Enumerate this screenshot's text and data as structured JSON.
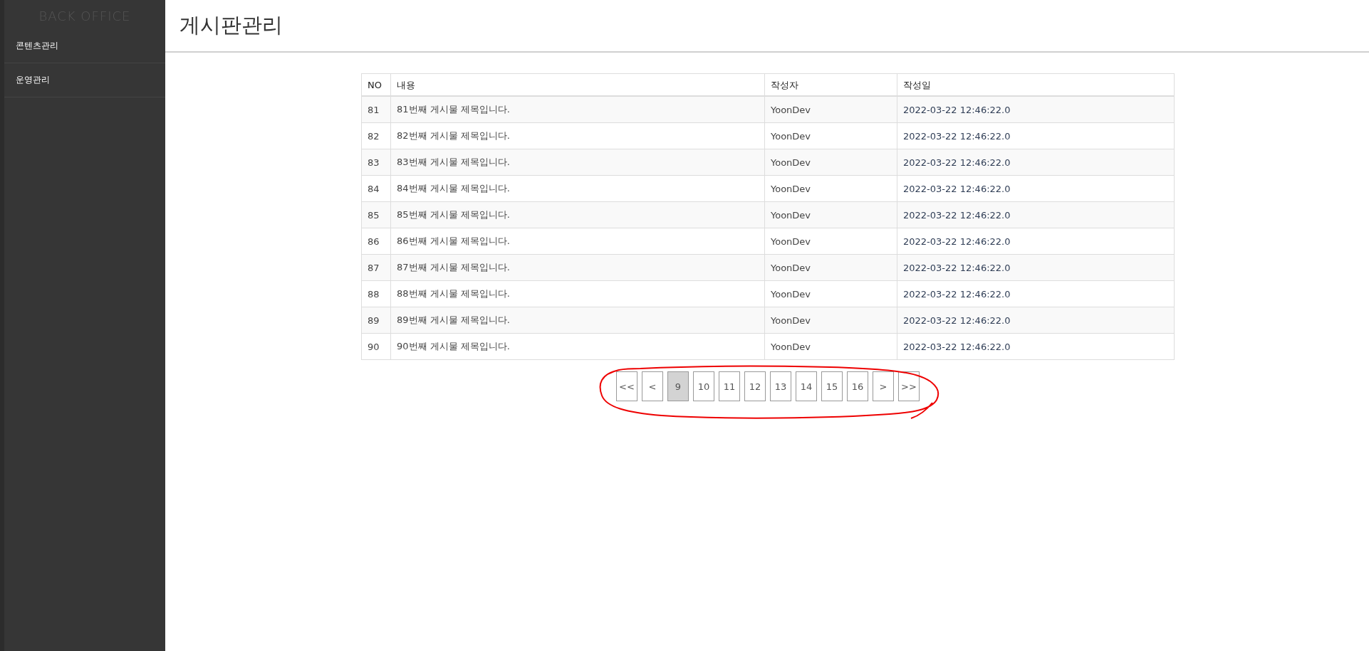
{
  "sidebar": {
    "logo": "BACK OFFICE",
    "items": [
      {
        "label": "콘텐츠관리"
      },
      {
        "label": "운영관리"
      }
    ]
  },
  "page_title": "게시판관리",
  "table": {
    "columns": [
      "NO",
      "내용",
      "작성자",
      "작성일"
    ],
    "rows": [
      [
        "81",
        "81번째 게시물 제목입니다.",
        "YoonDev",
        "2022-03-22 12:46:22.0"
      ],
      [
        "82",
        "82번째 게시물 제목입니다.",
        "YoonDev",
        "2022-03-22 12:46:22.0"
      ],
      [
        "83",
        "83번째 게시물 제목입니다.",
        "YoonDev",
        "2022-03-22 12:46:22.0"
      ],
      [
        "84",
        "84번째 게시물 제목입니다.",
        "YoonDev",
        "2022-03-22 12:46:22.0"
      ],
      [
        "85",
        "85번째 게시물 제목입니다.",
        "YoonDev",
        "2022-03-22 12:46:22.0"
      ],
      [
        "86",
        "86번째 게시물 제목입니다.",
        "YoonDev",
        "2022-03-22 12:46:22.0"
      ],
      [
        "87",
        "87번째 게시물 제목입니다.",
        "YoonDev",
        "2022-03-22 12:46:22.0"
      ],
      [
        "88",
        "88번째 게시물 제목입니다.",
        "YoonDev",
        "2022-03-22 12:46:22.0"
      ],
      [
        "89",
        "89번째 게시물 제목입니다.",
        "YoonDev",
        "2022-03-22 12:46:22.0"
      ],
      [
        "90",
        "90번째 게시물 제목입니다.",
        "YoonDev",
        "2022-03-22 12:46:22.0"
      ]
    ]
  },
  "pagination": [
    {
      "label": "<<",
      "selected": false
    },
    {
      "label": "<",
      "selected": false
    },
    {
      "label": "9",
      "selected": true
    },
    {
      "label": "10",
      "selected": false
    },
    {
      "label": "11",
      "selected": false
    },
    {
      "label": "12",
      "selected": false
    },
    {
      "label": "13",
      "selected": false
    },
    {
      "label": "14",
      "selected": false
    },
    {
      "label": "15",
      "selected": false
    },
    {
      "label": "16",
      "selected": false
    },
    {
      "label": ">",
      "selected": false
    },
    {
      "label": ">>",
      "selected": false
    }
  ]
}
